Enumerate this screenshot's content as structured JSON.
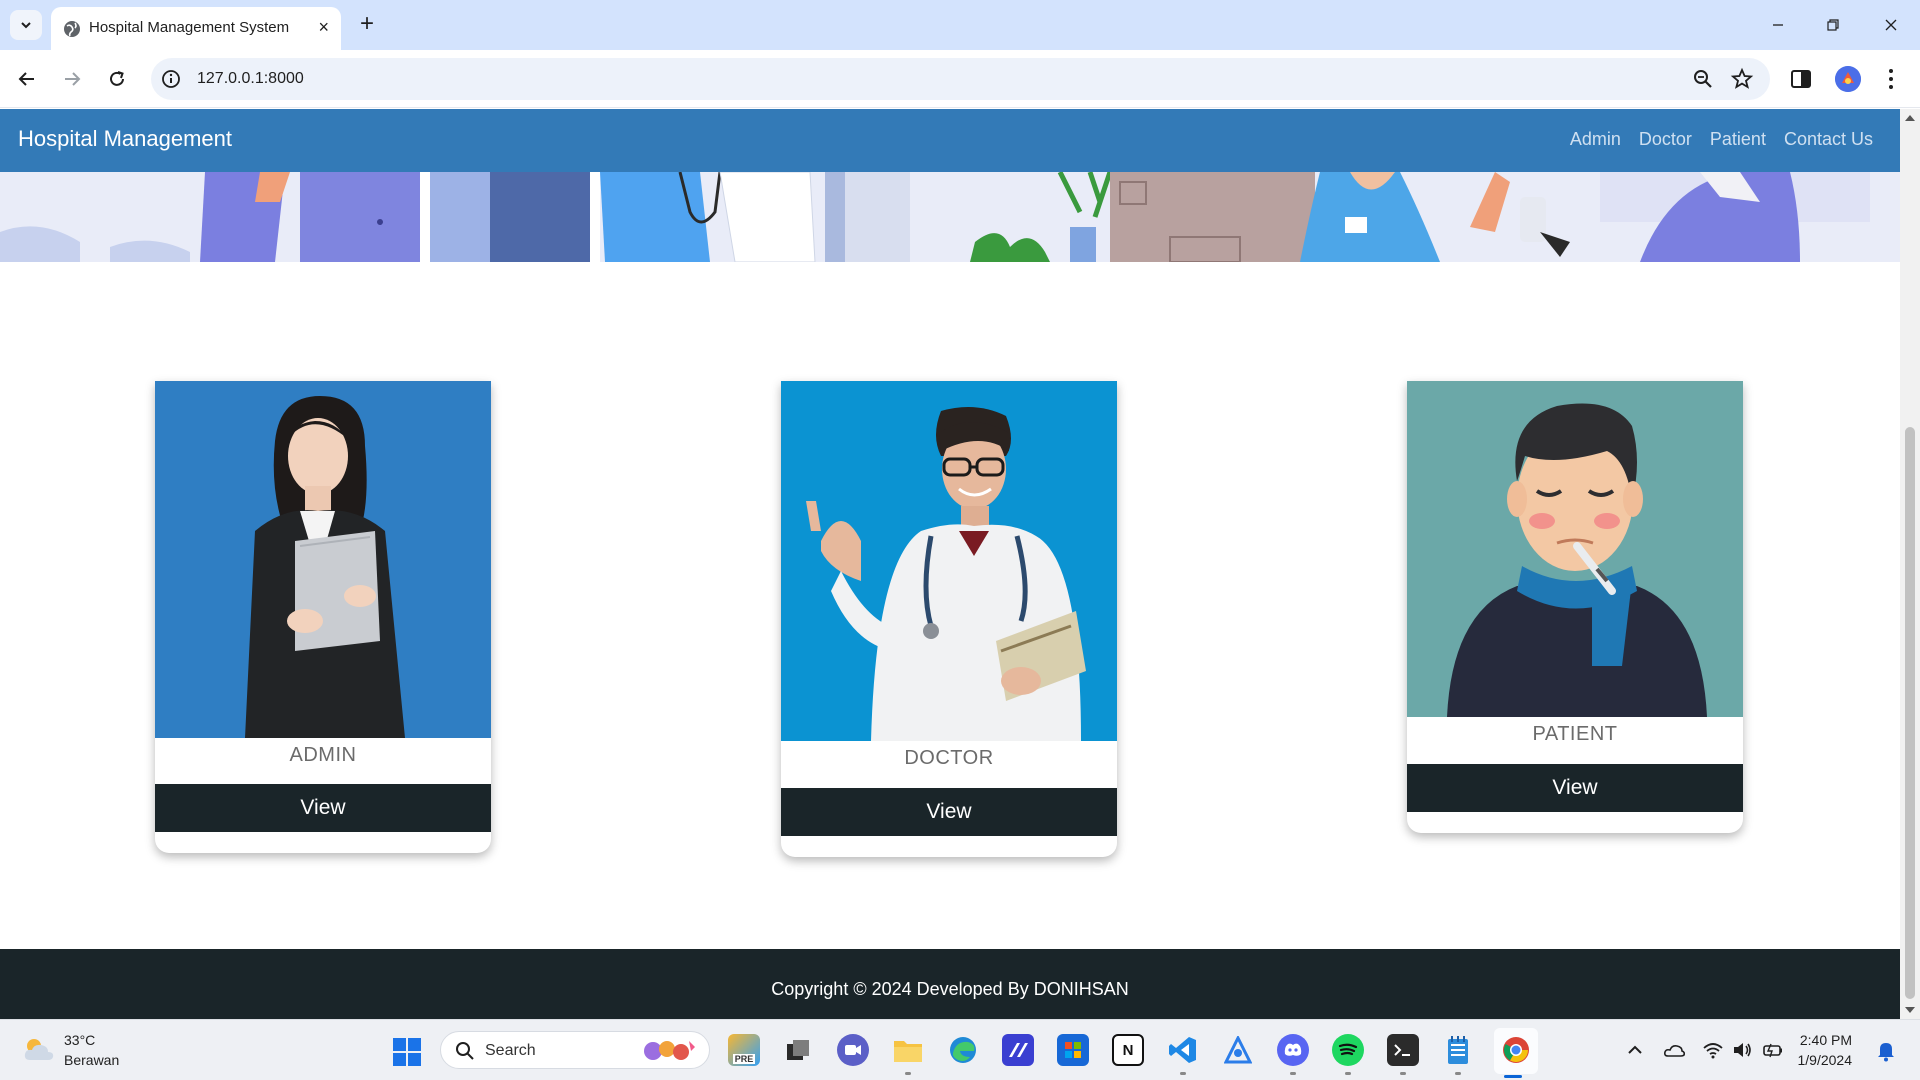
{
  "browser": {
    "tab_title": "Hospital Management System",
    "tab_close": "×",
    "new_tab": "+",
    "url": "127.0.0.1:8000"
  },
  "site": {
    "brand": "Hospital Management",
    "nav_links": [
      "Admin",
      "Doctor",
      "Patient",
      "Contact Us"
    ],
    "cards": [
      {
        "label": "ADMIN",
        "button": "View"
      },
      {
        "label": "DOCTOR",
        "button": "View"
      },
      {
        "label": "PATIENT",
        "button": "View"
      }
    ],
    "footer": "Copyright © 2024 Developed By DONIHSAN"
  },
  "taskbar": {
    "weather_temp": "33°C",
    "weather_desc": "Berawan",
    "search_placeholder": "Search",
    "apps": [
      "copilot-icon",
      "task-view-icon",
      "teams-icon",
      "file-explorer-icon",
      "edge-icon",
      "powerautomate-icon",
      "store-icon",
      "notion-icon",
      "vscode-icon",
      "azure-data-studio-icon",
      "discord-icon",
      "spotify-icon",
      "terminal-icon",
      "notepad-icon",
      "chrome-icon"
    ],
    "time": "2:40 PM",
    "date": "1/9/2024"
  },
  "colors": {
    "navbar": "#337ab7",
    "dark": "#1a2529",
    "tabbar": "#d3e3fd"
  }
}
